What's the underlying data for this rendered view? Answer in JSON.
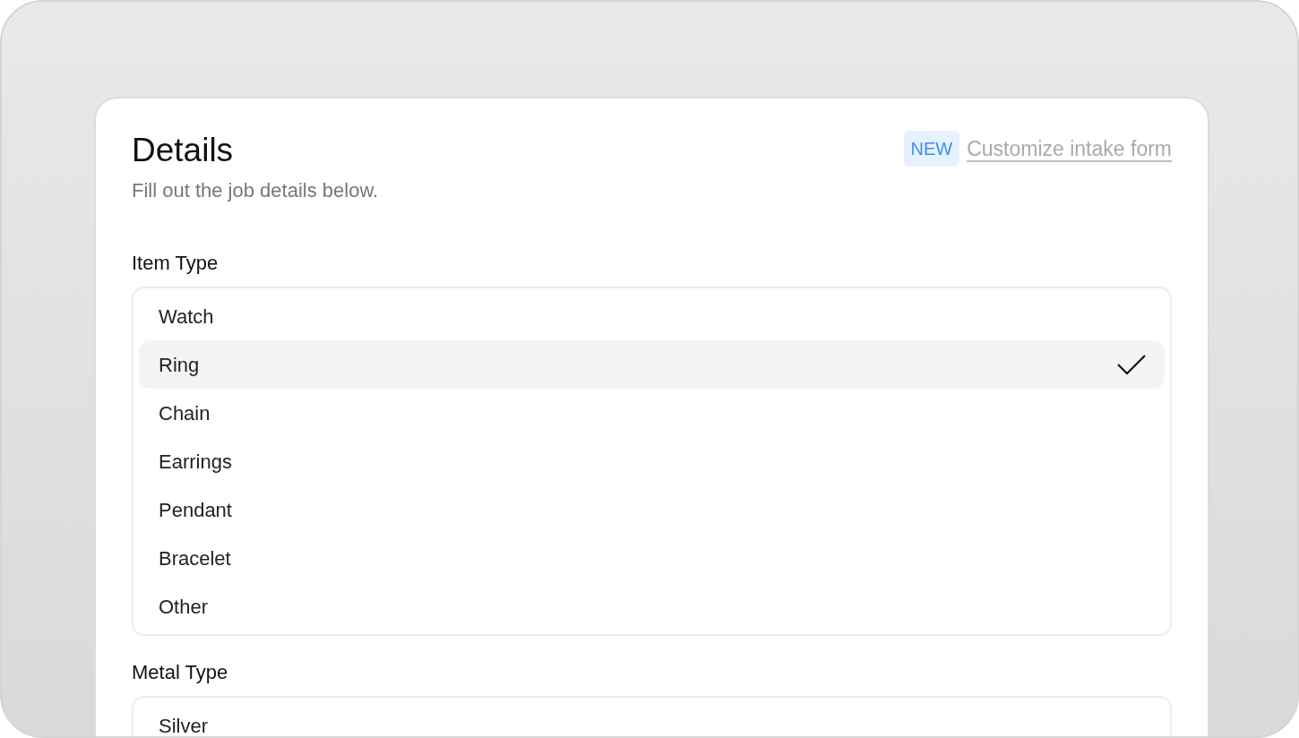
{
  "header": {
    "title": "Details",
    "subtitle": "Fill out the job details below.",
    "badge": "NEW",
    "link": "Customize intake form"
  },
  "fields": [
    {
      "label": "Item Type",
      "options": [
        {
          "label": "Watch",
          "selected": false
        },
        {
          "label": "Ring",
          "selected": true
        },
        {
          "label": "Chain",
          "selected": false
        },
        {
          "label": "Earrings",
          "selected": false
        },
        {
          "label": "Pendant",
          "selected": false
        },
        {
          "label": "Bracelet",
          "selected": false
        },
        {
          "label": "Other",
          "selected": false
        }
      ]
    },
    {
      "label": "Metal Type",
      "options": [
        {
          "label": "Silver",
          "selected": false
        }
      ]
    }
  ]
}
